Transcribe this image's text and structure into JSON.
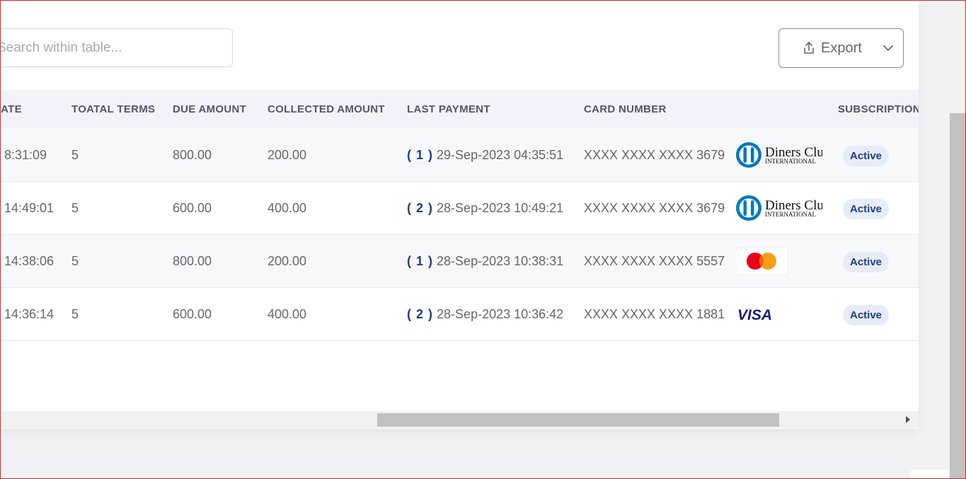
{
  "search": {
    "placeholder": "Search within table..."
  },
  "toolbar": {
    "export_label": "Export"
  },
  "table": {
    "headers": {
      "date": "DATE",
      "total_terms": "TOATAL TERMS",
      "due_amount": "DUE AMOUNT",
      "collected_amount": "COLLECTED AMOUNT",
      "last_payment": "LAST PAYMENT",
      "card_number": "CARD NUMBER",
      "subscription": "SUBSCRIPTION"
    },
    "rows": [
      {
        "date_time": "8:31:09",
        "terms": "5",
        "due": "800.00",
        "collected": "200.00",
        "payment_count": "( 1 )",
        "payment_date": "29-Sep-2023 04:35:51",
        "card": "XXXX XXXX XXXX 3679",
        "card_brand": "diners-club-logo",
        "status": "Active"
      },
      {
        "date_time": "14:49:01",
        "terms": "5",
        "due": "600.00",
        "collected": "400.00",
        "payment_count": "( 2 )",
        "payment_date": "28-Sep-2023 10:49:21",
        "card": "XXXX XXXX XXXX 3679",
        "card_brand": "diners-club-logo",
        "status": "Active"
      },
      {
        "date_time": "14:38:06",
        "terms": "5",
        "due": "800.00",
        "collected": "200.00",
        "payment_count": "( 1 )",
        "payment_date": "28-Sep-2023 10:38:31",
        "card": "XXXX XXXX XXXX 5557",
        "card_brand": "mastercard-logo",
        "status": "Active"
      },
      {
        "date_time": "14:36:14",
        "terms": "5",
        "due": "600.00",
        "collected": "400.00",
        "payment_count": "( 2 )",
        "payment_date": "28-Sep-2023 10:36:42",
        "card": "XXXX XXXX XXXX 1881",
        "card_brand": "visa-logo",
        "status": "Active"
      }
    ]
  },
  "logos": {
    "diners_line1": "Diners Club",
    "diners_line2": "INTERNATIONAL",
    "visa": "VISA"
  },
  "colors": {
    "accent": "#1b3f8a",
    "badge_bg": "#e8ebf8",
    "mastercard_red": "#eb001b",
    "mastercard_orange": "#f79e1b",
    "diners_blue": "#0079be"
  }
}
